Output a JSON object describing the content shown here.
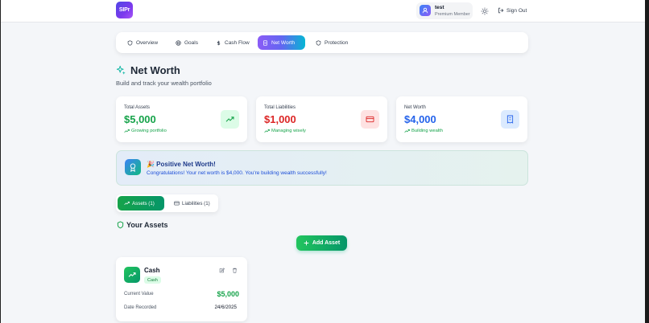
{
  "header": {
    "logo_text": "SIPr",
    "user_name": "test",
    "user_role": "Premium Member",
    "signout_label": "Sign Out"
  },
  "nav": {
    "tabs": [
      {
        "label": "Overview",
        "icon": "shield-icon"
      },
      {
        "label": "Goals",
        "icon": "target-icon"
      },
      {
        "label": "Cash Flow",
        "icon": "dollar-icon"
      },
      {
        "label": "Net Worth",
        "icon": "document-icon",
        "active": true
      },
      {
        "label": "Protection",
        "icon": "shield-icon"
      }
    ]
  },
  "page": {
    "title": "Net Worth",
    "subtitle": "Build and track your wealth portfolio"
  },
  "stats": [
    {
      "label": "Total Assets",
      "value": "$5,000",
      "sub": "Growing portfolio",
      "color": "#16a34a",
      "icon": "trending-up-icon",
      "icon_bg": "#dcfce7"
    },
    {
      "label": "Total Liabilities",
      "value": "$1,000",
      "sub": "Managing wisely",
      "color": "#dc2626",
      "icon": "credit-card-icon",
      "icon_bg": "#fee2e2"
    },
    {
      "label": "Net Worth",
      "value": "$4,000",
      "sub": "Building wealth",
      "color": "#2563eb",
      "icon": "receipt-icon",
      "icon_bg": "#dbeafe"
    }
  ],
  "banner": {
    "title": "🎉 Positive Net Worth!",
    "text": "Congratulations! Your net worth is $4,000. You're building wealth successfully!"
  },
  "segments": {
    "assets_label": "Assets (1)",
    "liabilities_label": "Liabilities (1)"
  },
  "section": {
    "title": "Your Assets",
    "add_label": "Add Asset"
  },
  "asset": {
    "name": "Cash",
    "badge": "Cash",
    "value_label": "Current Value",
    "value": "$5,000",
    "date_label": "Date Recorded",
    "date": "24/6/2025"
  },
  "colors": {
    "accent_green": "#16a34a",
    "accent_red": "#dc2626",
    "accent_blue": "#2563eb",
    "nav_active_start": "#8b5cf6",
    "nav_active_end": "#06b6d4"
  }
}
